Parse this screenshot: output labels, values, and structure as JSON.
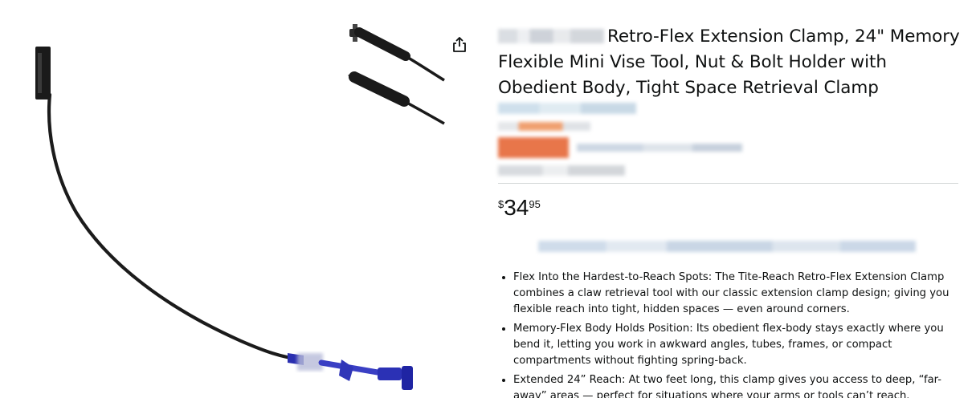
{
  "product": {
    "title": "Retro-Flex Extension Clamp, 24\" Memory Flexible Mini Vise Tool, Nut & Bolt Holder with Obedient Body, Tight Space Retrieval Clamp",
    "price": {
      "symbol": "$",
      "whole": "34",
      "fraction": "95"
    },
    "bullets": [
      "Flex Into the Hardest-to-Reach Spots: The Tite-Reach Retro-Flex Extension Clamp combines a claw retrieval tool with our classic extension clamp design; giving you flexible reach into tight, hidden spaces — even around corners.",
      "Memory-Flex Body Holds Position: Its obedient flex-body stays exactly where you bend it, letting you work in awkward angles, tubes, frames, or compact compartments without fighting spring-back.",
      "Extended 24” Reach: At two feet long, this clamp gives you access to deep, “far-away” areas — perfect for situations where your arms or tools can’t reach."
    ]
  },
  "icons": {
    "share": "share-icon"
  },
  "colors": {
    "text": "#0f1111",
    "divider": "#d5d9d9",
    "tool_accent": "#3a3fc4"
  }
}
